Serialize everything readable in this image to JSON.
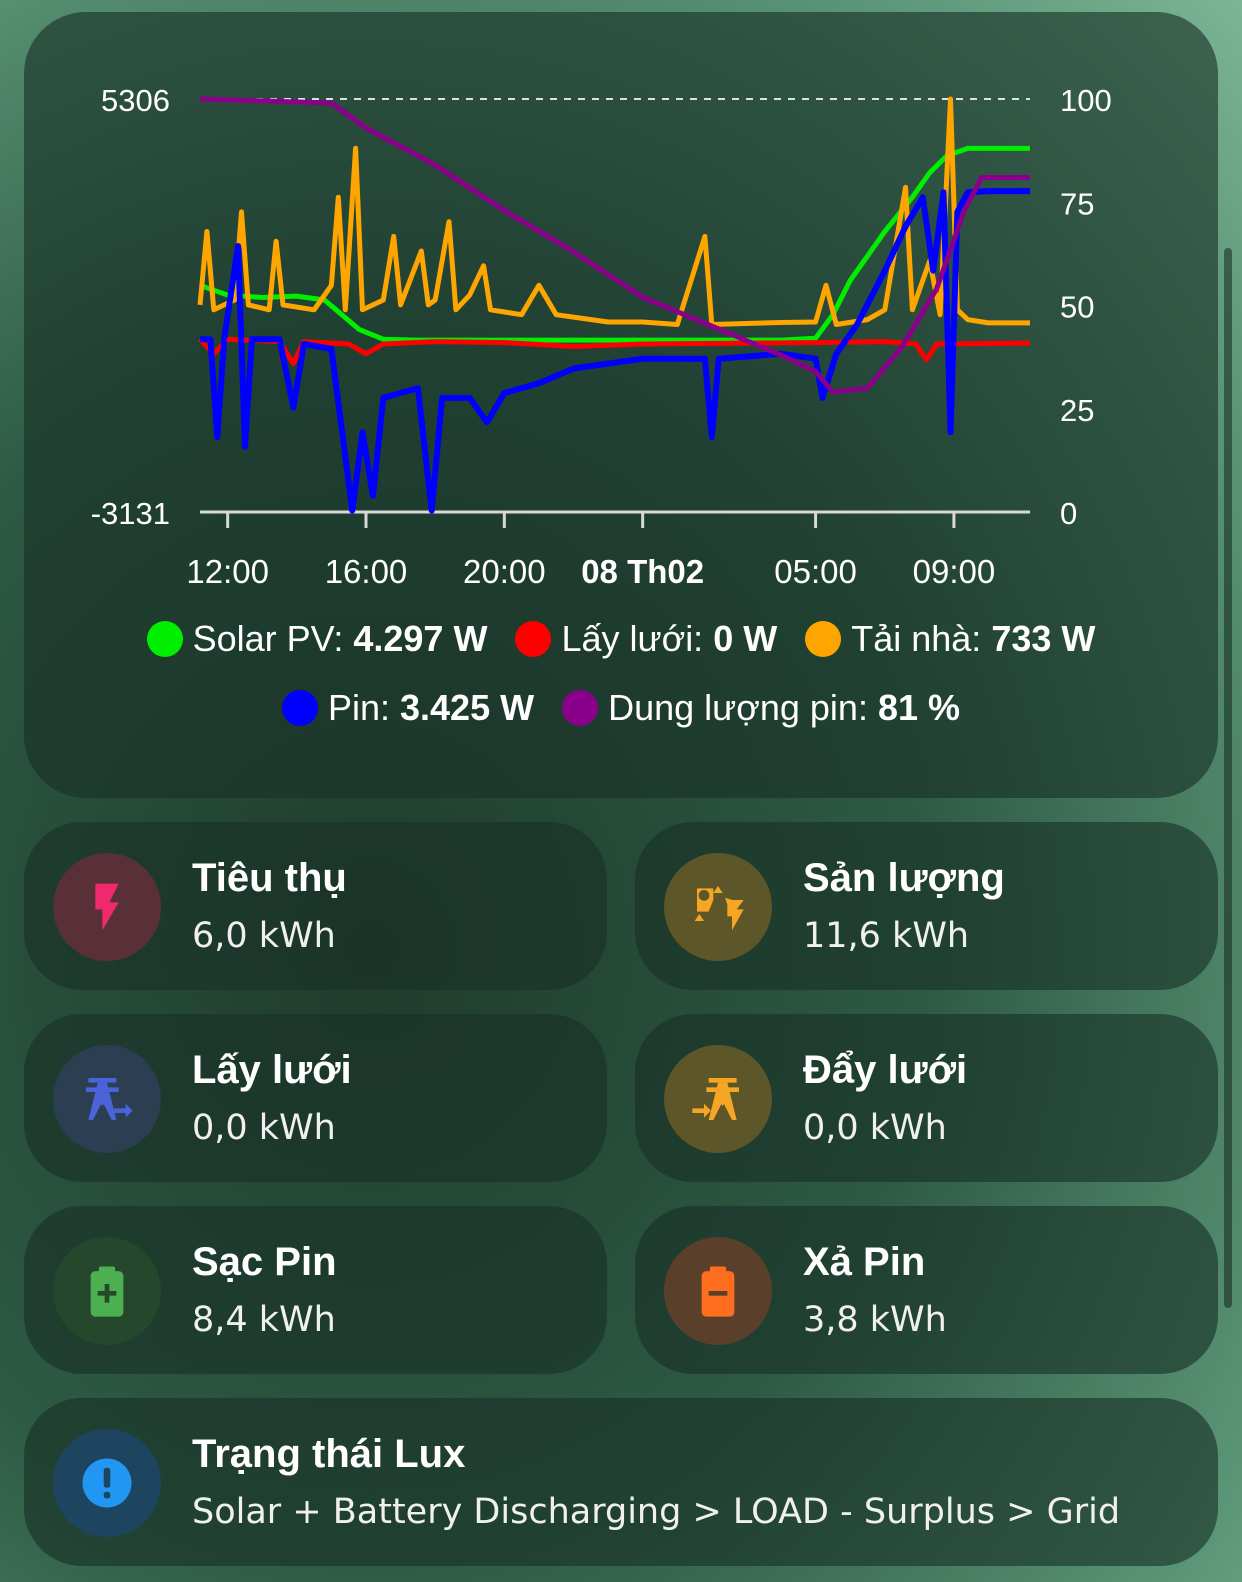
{
  "chart_data": {
    "type": "line",
    "left_axis": {
      "max_label": "5306",
      "min_label": "-3131",
      "min": -3131,
      "max": 5306
    },
    "right_axis": {
      "ticks": [
        "100",
        "75",
        "50",
        "25",
        "0"
      ],
      "min": 0,
      "max": 100
    },
    "x_ticks": [
      {
        "label": "12:00",
        "bold": false,
        "h": 12
      },
      {
        "label": "16:00",
        "bold": false,
        "h": 16
      },
      {
        "label": "20:00",
        "bold": false,
        "h": 20
      },
      {
        "label": "08 Th02",
        "bold": true,
        "h": 24
      },
      {
        "label": "05:00",
        "bold": false,
        "h": 29
      },
      {
        "label": "09:00",
        "bold": false,
        "h": 33
      }
    ],
    "x_range_hours": [
      11.2,
      35.2
    ],
    "series": [
      {
        "name": "Solar PV",
        "color": "#00ee00",
        "axis": "left",
        "width": 5,
        "points": [
          [
            11.2,
            1500
          ],
          [
            12,
            1300
          ],
          [
            13,
            1250
          ],
          [
            14,
            1280
          ],
          [
            14.8,
            1200
          ],
          [
            15.3,
            900
          ],
          [
            15.8,
            600
          ],
          [
            16.5,
            400
          ],
          [
            17.5,
            380
          ],
          [
            20,
            380
          ],
          [
            24,
            380
          ],
          [
            28,
            380
          ],
          [
            29,
            420
          ],
          [
            29.5,
            900
          ],
          [
            30,
            1600
          ],
          [
            31,
            2600
          ],
          [
            31.8,
            3300
          ],
          [
            32.3,
            3800
          ],
          [
            32.8,
            4150
          ],
          [
            33.4,
            4297
          ],
          [
            35.2,
            4297
          ]
        ]
      },
      {
        "name": "Lấy lưới",
        "color": "#ff0000",
        "axis": "left",
        "width": 5,
        "points": [
          [
            11.2,
            400
          ],
          [
            11.6,
            100
          ],
          [
            12,
            400
          ],
          [
            13.5,
            350
          ],
          [
            13.9,
            -100
          ],
          [
            14.2,
            350
          ],
          [
            15.5,
            300
          ],
          [
            16,
            100
          ],
          [
            16.5,
            300
          ],
          [
            18,
            350
          ],
          [
            20,
            330
          ],
          [
            22,
            250
          ],
          [
            24,
            300
          ],
          [
            27,
            320
          ],
          [
            29,
            330
          ],
          [
            30,
            340
          ],
          [
            31,
            350
          ],
          [
            31.9,
            300
          ],
          [
            32.2,
            -20
          ],
          [
            32.5,
            300
          ],
          [
            35.2,
            320
          ]
        ]
      },
      {
        "name": "Tải nhà",
        "color": "#ffa500",
        "axis": "left",
        "width": 5,
        "points": [
          [
            11.2,
            1100
          ],
          [
            11.4,
            2600
          ],
          [
            11.6,
            1000
          ],
          [
            12.2,
            1200
          ],
          [
            12.4,
            3000
          ],
          [
            12.6,
            1100
          ],
          [
            13.2,
            1000
          ],
          [
            13.4,
            2400
          ],
          [
            13.6,
            1100
          ],
          [
            14.5,
            1000
          ],
          [
            15,
            1500
          ],
          [
            15.2,
            3300
          ],
          [
            15.4,
            1000
          ],
          [
            15.7,
            4300
          ],
          [
            15.9,
            1000
          ],
          [
            16.5,
            1200
          ],
          [
            16.8,
            2500
          ],
          [
            17,
            1100
          ],
          [
            17.6,
            2200
          ],
          [
            17.8,
            1100
          ],
          [
            18,
            1200
          ],
          [
            18.4,
            2800
          ],
          [
            18.6,
            1000
          ],
          [
            19,
            1300
          ],
          [
            19.4,
            1900
          ],
          [
            19.6,
            1000
          ],
          [
            20.5,
            900
          ],
          [
            21,
            1500
          ],
          [
            21.5,
            900
          ],
          [
            23,
            750
          ],
          [
            24,
            750
          ],
          [
            25,
            700
          ],
          [
            25.8,
            2500
          ],
          [
            26,
            700
          ],
          [
            28,
            740
          ],
          [
            29,
            750
          ],
          [
            29.3,
            1500
          ],
          [
            29.6,
            700
          ],
          [
            30.5,
            800
          ],
          [
            31,
            1000
          ],
          [
            31.6,
            3500
          ],
          [
            31.8,
            1000
          ],
          [
            32.3,
            2000
          ],
          [
            32.6,
            900
          ],
          [
            32.9,
            5306
          ],
          [
            33.1,
            1000
          ],
          [
            33.4,
            800
          ],
          [
            34,
            733
          ],
          [
            35.2,
            733
          ]
        ]
      },
      {
        "name": "Pin",
        "color": "#0000ff",
        "axis": "left",
        "width": 6,
        "points": [
          [
            11.2,
            400
          ],
          [
            11.5,
            400
          ],
          [
            11.7,
            -1600
          ],
          [
            11.9,
            400
          ],
          [
            12.3,
            2300
          ],
          [
            12.5,
            -1800
          ],
          [
            12.7,
            400
          ],
          [
            13.5,
            400
          ],
          [
            13.9,
            -1000
          ],
          [
            14.2,
            300
          ],
          [
            15,
            200
          ],
          [
            15.4,
            -2000
          ],
          [
            15.6,
            -3100
          ],
          [
            15.9,
            -1500
          ],
          [
            16.2,
            -2800
          ],
          [
            16.5,
            -800
          ],
          [
            17.5,
            -600
          ],
          [
            17.9,
            -3100
          ],
          [
            18.2,
            -800
          ],
          [
            19,
            -800
          ],
          [
            19.5,
            -1300
          ],
          [
            20,
            -700
          ],
          [
            21,
            -500
          ],
          [
            22,
            -200
          ],
          [
            24,
            0
          ],
          [
            25.8,
            0
          ],
          [
            26,
            -1600
          ],
          [
            26.2,
            0
          ],
          [
            28,
            100
          ],
          [
            29,
            0
          ],
          [
            29.2,
            -800
          ],
          [
            29.6,
            100
          ],
          [
            30.2,
            700
          ],
          [
            31,
            1800
          ],
          [
            31.6,
            2700
          ],
          [
            32.1,
            3300
          ],
          [
            32.4,
            1800
          ],
          [
            32.7,
            3400
          ],
          [
            32.9,
            -1500
          ],
          [
            33.1,
            3000
          ],
          [
            33.4,
            3400
          ],
          [
            34,
            3425
          ],
          [
            35.2,
            3425
          ]
        ]
      },
      {
        "name": "Dung lượng pin",
        "color": "#8b008b",
        "axis": "right",
        "width": 5,
        "points": [
          [
            11.2,
            100
          ],
          [
            15,
            99
          ],
          [
            16,
            93
          ],
          [
            18,
            84
          ],
          [
            20,
            73
          ],
          [
            22,
            63
          ],
          [
            24,
            52
          ],
          [
            26,
            45
          ],
          [
            28,
            38
          ],
          [
            29,
            34
          ],
          [
            29.5,
            29
          ],
          [
            30.5,
            30
          ],
          [
            31.5,
            40
          ],
          [
            32.5,
            54
          ],
          [
            33.3,
            73
          ],
          [
            33.8,
            81
          ],
          [
            35.2,
            81
          ]
        ]
      }
    ]
  },
  "legend": {
    "row1": [
      {
        "label": "Solar PV: ",
        "value": "4.297 W",
        "color": "#00ee00"
      },
      {
        "label": "Lấy lưới: ",
        "value": "0 W",
        "color": "#ff0000"
      },
      {
        "label": "Tải nhà: ",
        "value": "733 W",
        "color": "#ffa500"
      }
    ],
    "row2": [
      {
        "label": "Pin: ",
        "value": "3.425 W",
        "color": "#0000ff"
      },
      {
        "label": "Dung lượng pin: ",
        "value": "81 %",
        "color": "#8b008b"
      }
    ]
  },
  "tiles": [
    {
      "id": "consumption",
      "title": "Tiêu thụ",
      "value": "6,0 kWh",
      "icon": "lightning-icon",
      "icon_color": "#f0286e",
      "bg": "#5a3038"
    },
    {
      "id": "production",
      "title": "Sản lượng",
      "value": "11,6 kWh",
      "icon": "solar-power-icon",
      "icon_color": "#f5a623",
      "bg": "#5d5629"
    },
    {
      "id": "grid-import",
      "title": "Lấy lưới",
      "value": "0,0 kWh",
      "icon": "transmission-tower-import-icon",
      "icon_color": "#4a63d8",
      "bg": "#2c3e52"
    },
    {
      "id": "grid-export",
      "title": "Đẩy lưới",
      "value": "0,0 kWh",
      "icon": "transmission-tower-export-icon",
      "icon_color": "#f5a623",
      "bg": "#5d5629"
    },
    {
      "id": "battery-charge",
      "title": "Sạc Pin",
      "value": "8,4 kWh",
      "icon": "battery-plus-icon",
      "icon_color": "#4caf50",
      "bg": "#25472c"
    },
    {
      "id": "battery-discharge",
      "title": "Xả Pin",
      "value": "3,8 kWh",
      "icon": "battery-minus-icon",
      "icon_color": "#ff6d1f",
      "bg": "#5a3f2a"
    }
  ],
  "status": {
    "title": "Trạng thái Lux",
    "value": "Solar + Battery Discharging > LOAD - Surplus > Grid",
    "icon": "alert-circle-icon",
    "icon_color": "#2196f3",
    "bg": "#1e4560"
  }
}
